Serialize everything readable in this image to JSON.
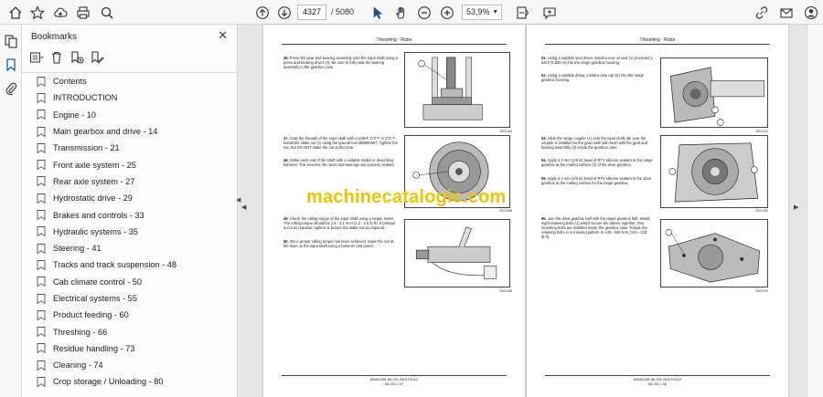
{
  "toolbar": {
    "page_current": "4327",
    "page_total": "/ 5080",
    "zoom": "53,9%"
  },
  "bookmarks": {
    "title": "Bookmarks",
    "close": "✕",
    "items": [
      "Contents",
      "INTRODUCTION",
      "Engine - 10",
      "Main gearbox and drive - 14",
      "Transmission - 21",
      "Front axle system - 25",
      "Rear axle system - 27",
      "Hydrostatic drive - 29",
      "Brakes and controls - 33",
      "Hydraulic systems - 35",
      "Steering - 41",
      "Tracks and track suspension - 48",
      "Cab climate control - 50",
      "Electrical systems - 55",
      "Product feeding - 60",
      "Threshing - 66",
      "Residue handling - 73",
      "Cleaning - 74",
      "Crop storage / Unloading - 80"
    ]
  },
  "watermark": "machinecatalogic.com",
  "left_page": {
    "header": "Threshing - Rotor",
    "footer_line1": "84591195-66.331 24/07/2012",
    "footer_line2": "66.331 / 47",
    "steps": [
      {
        "num": "46.",
        "text": "Press the gear and bearing assembly onto the input shaft using a press and bearing driver (3). Be sure to fully seat the bearing assembly in the gearbox case."
      },
      {
        "num": "47.",
        "text": "Coat the threads of the input shaft with Loctite® 272™ or 271™. Install the stake nut (1) using the special tool 380000657. Tighten the nut, but DO NOT stake the nut at this time."
      },
      {
        "num": "48.",
        "text": "Strike each end of the shaft with a suitable mallet or dead blow hammer. This ensures the races and bearings are properly seated."
      },
      {
        "num": "49.",
        "text": "Check the rolling torque of the input shaft using a torque meter. The rolling torque should be 1.6 - 2.1 N·m (1.2 - 1.6 lb·ft). If preload is not as required, tighten or loosen the stake nut as required."
      },
      {
        "num": "50.",
        "text": "Once proper rolling torque has been achieved, stake the nut at the slots on the input shaft using a hammer and punch."
      }
    ],
    "fig_ids": [
      "20021064",
      "20021065",
      "20021066"
    ]
  },
  "right_page": {
    "header": "Threshing - Rotor",
    "footer_line1": "84591195-66.331 24/07/2012",
    "footer_line2": "66.331 / 48",
    "steps": [
      {
        "num": "51.",
        "text": "Using a suitable seal driver, install a new oil seal (1) (received 1 each (5.580 in) into the range gearbox housing."
      },
      {
        "num": "52.",
        "text": "Using a suitable driver, install a new cap (2) into the range gearbox housing."
      },
      {
        "num": "53.",
        "text": "Slide the range coupler (1) onto the input shaft. Be sure the coupler is installed so the gear teeth will mesh with the gear and bearing assembly (2) inside the gearbox case."
      },
      {
        "num": "54.",
        "text": "Apply a 3 mm (1/8 in) bead of RTV silicone sealant to the range gearbox at the mating surface (3) of the drive gearbox."
      },
      {
        "num": "55.",
        "text": "Apply a 3 mm (1/8 in) bead of RTV silicone sealant to the drive gearbox at the mating surface for the range gearbox."
      },
      {
        "num": "56.",
        "text": "Join the drive gearbox half with the range gearbox half. Install eight retaining bolts (1) which secure the halves together. Two mounting bolts are installed inside the gearbox case. Torque the retaining bolts in a crossing pattern to 140 - 180 N·m (103 - 133 lb·ft)."
      }
    ],
    "fig_ids": [
      "20021241",
      "20021262",
      "20021076"
    ]
  }
}
